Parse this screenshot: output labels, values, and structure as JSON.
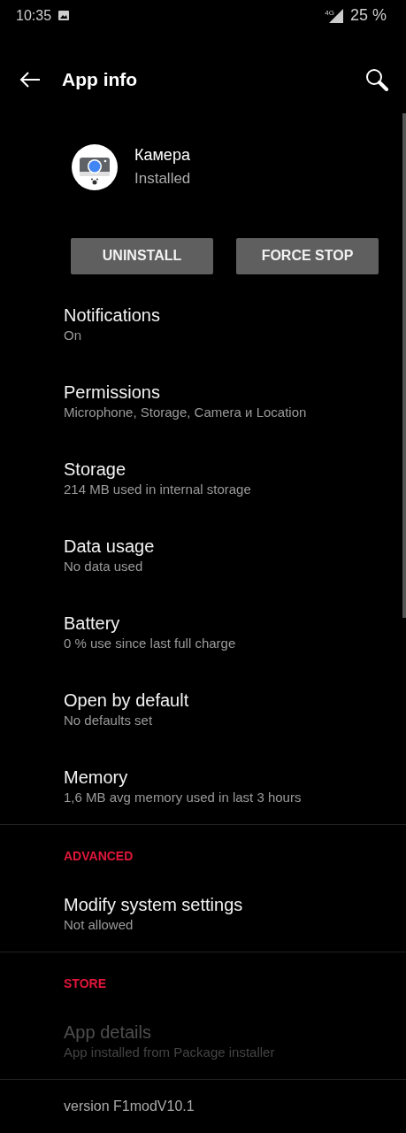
{
  "status_bar": {
    "time": "10:35",
    "network": "4G",
    "battery": "25 %"
  },
  "toolbar": {
    "title": "App info"
  },
  "app": {
    "name": "Камера",
    "status": "Installed"
  },
  "buttons": [
    "UNINSTALL",
    "FORCE STOP"
  ],
  "sections": [
    {
      "items": [
        {
          "title": "Notifications",
          "subtitle": "On",
          "disabled": false
        },
        {
          "title": "Permissions",
          "subtitle": "Microphone, Storage, Camera и Location",
          "disabled": false
        },
        {
          "title": "Storage",
          "subtitle": "214 MB used in internal storage",
          "disabled": false
        },
        {
          "title": "Data usage",
          "subtitle": "No data used",
          "disabled": false
        },
        {
          "title": "Battery",
          "subtitle": "0 % use since last full charge",
          "disabled": false
        },
        {
          "title": "Open by default",
          "subtitle": "No defaults set",
          "disabled": false
        },
        {
          "title": "Memory",
          "subtitle": "1,6 MB avg memory used in last 3 hours",
          "disabled": false
        }
      ]
    },
    {
      "header": "ADVANCED",
      "items": [
        {
          "title": "Modify system settings",
          "subtitle": "Not allowed",
          "disabled": false
        }
      ]
    },
    {
      "header": "STORE",
      "items": [
        {
          "title": "App details",
          "subtitle": "App installed from Package installer",
          "disabled": true
        }
      ]
    }
  ],
  "footer": "version F1modV10.1"
}
